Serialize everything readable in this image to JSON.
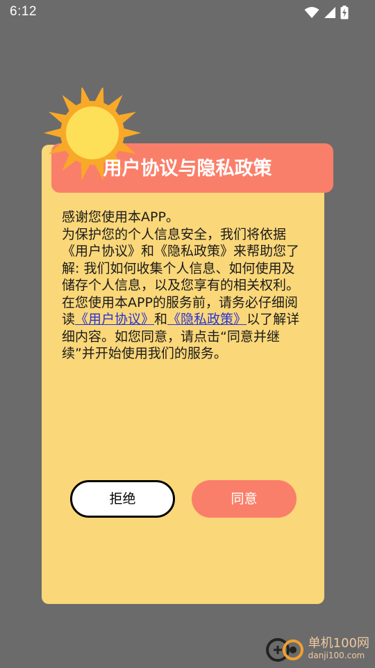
{
  "status": {
    "time": "6:12"
  },
  "dialog": {
    "title": "用户协议与隐私政策",
    "intro": "感谢您使用本APP。",
    "para1": "为保护您的个人信息安全，我们将依据《用户协议》和《隐私政策》来帮助您了解: 我们如何收集个人信息、如何使用及储存个人信息，以及您享有的相关权利。",
    "para2_prefix": "在您使用本APP的服务前，请务必仔细阅读",
    "link_user": "《用户协议》",
    "and": "和",
    "link_privacy": "《隐私政策》",
    "para2_suffix": "以了解详细内容。如您同意，请点击“同意并继续”并开始使用我们的服务。",
    "reject_label": "拒绝",
    "agree_label": "同意"
  },
  "colors": {
    "backdrop": "#6b6b6b",
    "dialog_bg": "#fad779",
    "accent": "#fa7f6a",
    "link": "#2b33d6"
  },
  "icons": [
    "wifi-icon",
    "signal-icon",
    "battery-charging-icon",
    "sun-icon"
  ],
  "watermark": {
    "title": "单机100网",
    "url": "danji100.com"
  }
}
